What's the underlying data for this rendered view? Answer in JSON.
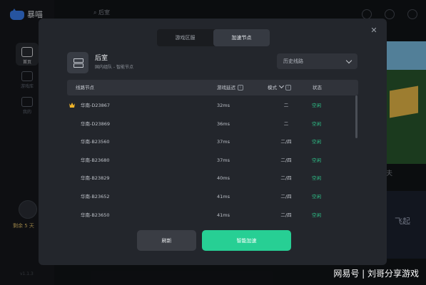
{
  "app": {
    "name": "暴喵",
    "nav_home": "首页",
    "nav_games": "游戏库",
    "nav_mine": "我的",
    "search_text": "后室",
    "user_days": "剩余 5 天",
    "version": "v1.1.3"
  },
  "background": {
    "banner_caption": "夫",
    "banner2_text": "飞起"
  },
  "modal": {
    "tabs": [
      "游戏区服",
      "加速节点"
    ],
    "active_tab": 1,
    "game_title": "后室",
    "game_subtitle": "国内组队 - 智能节点",
    "history_select": "历史线路",
    "table": {
      "headers": {
        "node": "线路节点",
        "latency": "游戏延迟",
        "mode": "模式",
        "status": "状态"
      },
      "rows": [
        {
          "node": "华南-D23867",
          "latency": "32ms",
          "mode": "二",
          "status": "空闲",
          "crown": true
        },
        {
          "node": "华南-D23869",
          "latency": "36ms",
          "mode": "二",
          "status": "空闲"
        },
        {
          "node": "华南-B23560",
          "latency": "37ms",
          "mode": "二/四",
          "status": "空闲"
        },
        {
          "node": "华南-B23680",
          "latency": "37ms",
          "mode": "二/四",
          "status": "空闲"
        },
        {
          "node": "华南-B23829",
          "latency": "40ms",
          "mode": "二/四",
          "status": "空闲"
        },
        {
          "node": "华南-B23652",
          "latency": "41ms",
          "mode": "二/四",
          "status": "空闲"
        },
        {
          "node": "华南-B23650",
          "latency": "41ms",
          "mode": "二/四",
          "status": "空闲"
        }
      ]
    },
    "refresh_label": "刷新",
    "accelerate_label": "智能加速",
    "close_symbol": "✕"
  },
  "watermark": "网易号 | 刘哥分享游戏",
  "colors": {
    "accent": "#27cf94",
    "status": "#2ec389",
    "modal_bg": "#23262c"
  }
}
